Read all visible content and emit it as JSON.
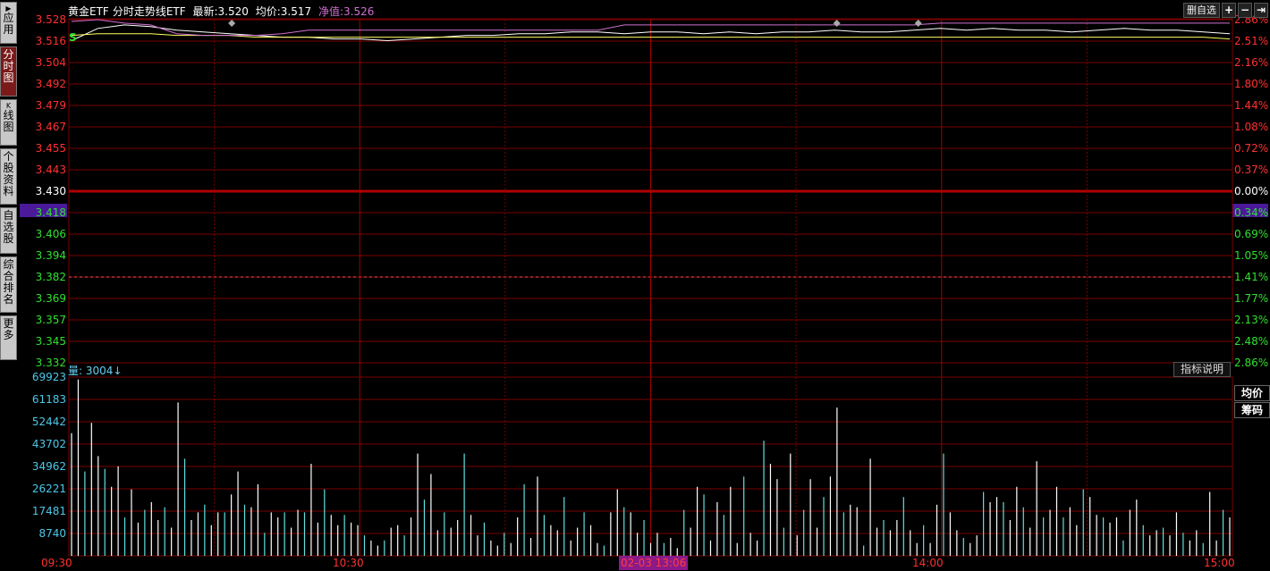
{
  "sidebar": {
    "tabs": [
      {
        "mark": "▶",
        "label": "应用",
        "active": false
      },
      {
        "mark": "",
        "label": "分时图",
        "active": true
      },
      {
        "mark": "K",
        "label": "线图",
        "active": false
      },
      {
        "mark": "",
        "label": "个股资料",
        "active": false
      },
      {
        "mark": "",
        "label": "自选股",
        "active": false
      },
      {
        "mark": "",
        "label": "综合排名",
        "active": false
      },
      {
        "mark": "",
        "label": "更多",
        "active": false
      }
    ]
  },
  "header": {
    "name": "黄金ETF",
    "chart_name": "分时走势线ETF",
    "latest_label": "最新:",
    "latest_value": "3.520",
    "avg_label": "均价:",
    "avg_value": "3.517",
    "nav_label": "净值:",
    "nav_value": "3.526"
  },
  "toolbar": {
    "delete_watch_label": "删自选",
    "icons": [
      "plus-icon",
      "minus-icon",
      "exit-icon"
    ]
  },
  "volume": {
    "label": "量: 3004",
    "arrow": "↓",
    "indicator_btn": "指标说明"
  },
  "right_buttons": [
    "均价",
    "筹码"
  ],
  "time_axis": {
    "labels": [
      "09:30",
      "10:30",
      "14:00",
      "15:00"
    ],
    "cursor_time": "02-03 13:06"
  },
  "colors": {
    "up": "#ff3030",
    "down": "#30e030",
    "grid": "#7a0000",
    "price_line": "#ffffff",
    "avg_line": "#ffff60",
    "nav_line": "#d070d0",
    "volume_up": "#ffffff",
    "volume_down": "#60e0e0",
    "cursor": "#4a1a9a"
  },
  "chart_data": {
    "type": "line",
    "price_axis_left": [
      "3.528",
      "3.516",
      "3.504",
      "3.492",
      "3.479",
      "3.467",
      "3.455",
      "3.443",
      "3.430",
      "3.418",
      "3.406",
      "3.394",
      "3.382",
      "3.369",
      "3.357",
      "3.345",
      "3.332"
    ],
    "pct_axis_right": [
      "2.86%",
      "2.51%",
      "2.16%",
      "1.80%",
      "1.44%",
      "1.08%",
      "0.72%",
      "0.37%",
      "0.00%",
      "0.34%",
      "0.69%",
      "1.05%",
      "1.41%",
      "1.77%",
      "2.13%",
      "2.48%",
      "2.86%"
    ],
    "ylim": [
      3.332,
      3.528
    ],
    "prev_close": 3.43,
    "cursor_price": 3.418,
    "volume_axis": [
      "69923",
      "61183",
      "52442",
      "43702",
      "34962",
      "26221",
      "17481",
      "8740"
    ],
    "volume_ylim": [
      0,
      69923
    ],
    "series": [
      {
        "name": "最新",
        "values": [
          3.516,
          3.523,
          3.525,
          3.524,
          3.522,
          3.521,
          3.52,
          3.519,
          3.518,
          3.518,
          3.517,
          3.517,
          3.516,
          3.517,
          3.518,
          3.519,
          3.519,
          3.52,
          3.52,
          3.521,
          3.521,
          3.52,
          3.521,
          3.521,
          3.52,
          3.521,
          3.52,
          3.521,
          3.521,
          3.522,
          3.521,
          3.521,
          3.522,
          3.523,
          3.522,
          3.523,
          3.522,
          3.522,
          3.521,
          3.522,
          3.523,
          3.522,
          3.522,
          3.521,
          3.52
        ]
      },
      {
        "name": "均价",
        "values": [
          3.519,
          3.52,
          3.52,
          3.52,
          3.519,
          3.519,
          3.519,
          3.518,
          3.518,
          3.518,
          3.518,
          3.518,
          3.518,
          3.518,
          3.518,
          3.518,
          3.518,
          3.518,
          3.518,
          3.518,
          3.518,
          3.518,
          3.518,
          3.518,
          3.518,
          3.518,
          3.518,
          3.518,
          3.518,
          3.518,
          3.518,
          3.518,
          3.518,
          3.518,
          3.518,
          3.518,
          3.518,
          3.518,
          3.518,
          3.518,
          3.518,
          3.518,
          3.518,
          3.518,
          3.517
        ]
      },
      {
        "name": "净值",
        "values": [
          3.527,
          3.528,
          3.526,
          3.525,
          3.52,
          3.519,
          3.519,
          3.519,
          3.52,
          3.522,
          3.522,
          3.522,
          3.522,
          3.522,
          3.522,
          3.522,
          3.522,
          3.522,
          3.522,
          3.522,
          3.522,
          3.525,
          3.525,
          3.525,
          3.525,
          3.525,
          3.525,
          3.525,
          3.525,
          3.525,
          3.525,
          3.525,
          3.525,
          3.526,
          3.526,
          3.526,
          3.526,
          3.526,
          3.526,
          3.526,
          3.526,
          3.526,
          3.526,
          3.526,
          3.526
        ]
      }
    ],
    "volume": [
      48000,
      69000,
      33000,
      52000,
      39000,
      34000,
      27000,
      35000,
      15000,
      26000,
      13000,
      18000,
      21000,
      14000,
      19000,
      11000,
      60000,
      38000,
      14000,
      17000,
      20000,
      12000,
      17000,
      17000,
      24000,
      33000,
      20000,
      19000,
      28000,
      9000,
      17000,
      15000,
      17000,
      11000,
      18000,
      17000,
      36000,
      13000,
      26000,
      16000,
      12000,
      16000,
      13000,
      12000,
      8000,
      6000,
      4000,
      6000,
      11000,
      12000,
      8000,
      15000,
      40000,
      22000,
      32000,
      10000,
      17000,
      11000,
      14000,
      40000,
      16000,
      8000,
      13000,
      6000,
      4000,
      9000,
      5000,
      15000,
      28000,
      7000,
      31000,
      16000,
      12000,
      10000,
      23000,
      6000,
      11000,
      17000,
      12000,
      5000,
      4000,
      17000,
      26000,
      19000,
      17000,
      9000,
      14000,
      5000,
      9000,
      5000,
      7000,
      3000,
      18000,
      11000,
      27000,
      24000,
      6000,
      21000,
      16000,
      27000,
      5000,
      31000,
      9000,
      6000,
      45000,
      36000,
      30000,
      11000,
      40000,
      8000,
      18000,
      30000,
      11000,
      23000,
      31000,
      58000,
      17000,
      20000,
      19000,
      4000,
      38000,
      11000,
      14000,
      10000,
      14000,
      23000,
      10000,
      5000,
      12000,
      5000,
      20000,
      40000,
      17000,
      10000,
      7000,
      5000,
      8000,
      25000,
      21000,
      23000,
      21000,
      14000,
      27000,
      19000,
      11000,
      37000,
      15000,
      18000,
      27000,
      15000,
      19000,
      12000,
      26000,
      23000,
      16000,
      15000,
      13000,
      15000,
      6000,
      18000,
      22000,
      12000,
      8000,
      10000,
      11000,
      8000,
      17000,
      9000,
      6000,
      10000,
      5000,
      25000,
      6000,
      18000,
      15000
    ]
  }
}
